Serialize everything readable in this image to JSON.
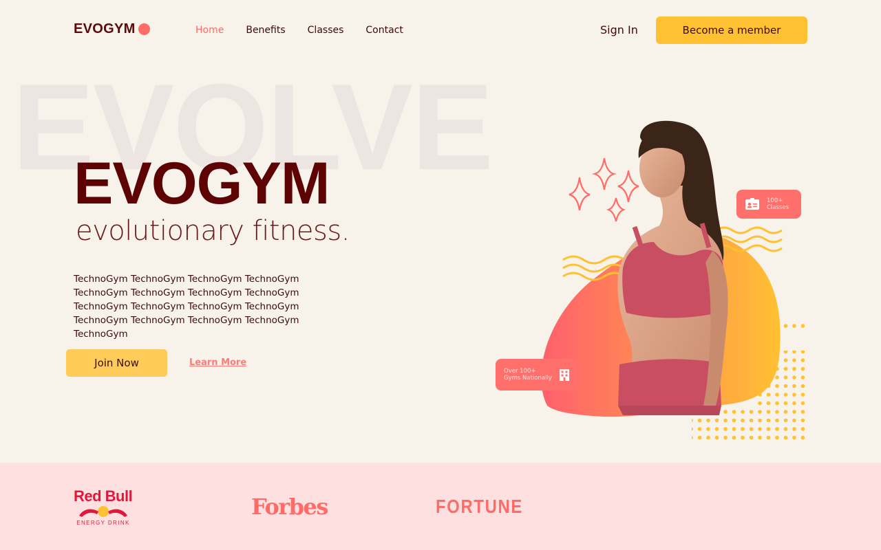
{
  "brand": {
    "name": "EVOGYM"
  },
  "nav": {
    "links": [
      {
        "label": "Home",
        "active": true
      },
      {
        "label": "Benefits",
        "active": false
      },
      {
        "label": "Classes",
        "active": false
      },
      {
        "label": "Contact",
        "active": false
      }
    ],
    "sign_in": "Sign In",
    "cta": "Become a member"
  },
  "hero": {
    "background_word": "EVOLVE",
    "title": "EVOGYM",
    "subtitle": "evolutionary fitness.",
    "description": "TechnoGym TechnoGym TechnoGym TechnoGym TechnoGym TechnoGym TechnoGym TechnoGym TechnoGym TechnoGym TechnoGym TechnoGym TechnoGym TechnoGym TechnoGym TechnoGym TechnoGym",
    "join_button": "Join Now",
    "learn_more": "Learn More",
    "badges": {
      "classes": {
        "line1": "100+",
        "line2": "Classes",
        "icon": "id-card-icon"
      },
      "gyms": {
        "line1": "Over 100+",
        "line2": "Gyms Nationally",
        "icon": "building-icon"
      }
    }
  },
  "sponsors": {
    "redbull": {
      "name": "Red Bull",
      "tagline": "ENERGY DRINK"
    },
    "forbes": "Forbes",
    "fortune": "FORTUNE"
  },
  "colors": {
    "background": "#f7f2ea",
    "primary_dark": "#5e0303",
    "accent_red": "#ff6b66",
    "accent_yellow": "#ffc132",
    "sponsor_band": "#ffe0e0"
  }
}
